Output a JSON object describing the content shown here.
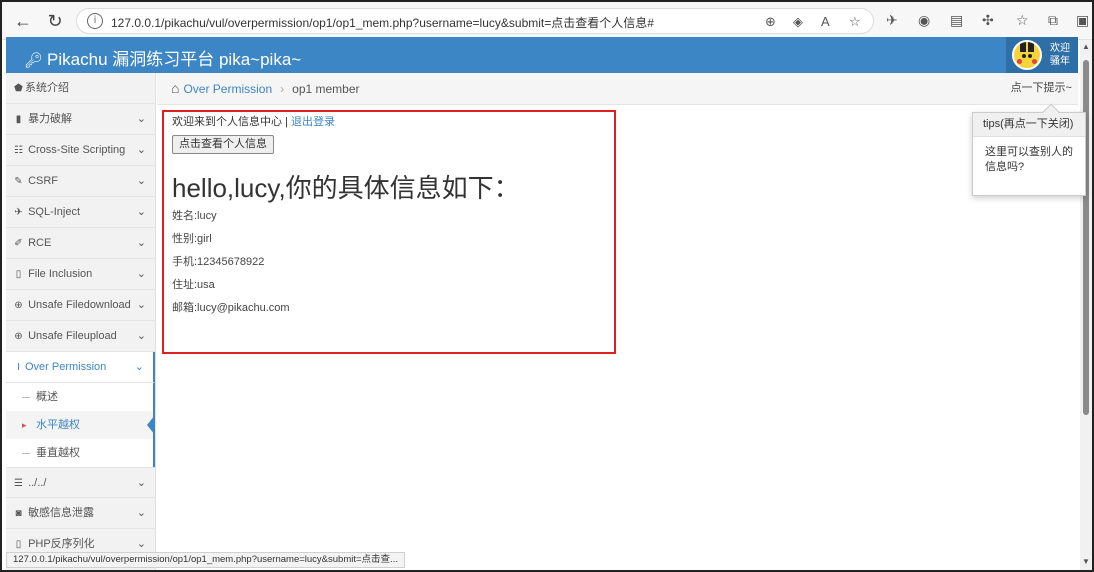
{
  "browser": {
    "back_glyph": "←",
    "reload_glyph": "↻",
    "url": "127.0.0.1/pikachu/vul/overpermission/op1/op1_mem.php?username=lucy&submit=点击查看个人信息#",
    "read_aloud_label": "A"
  },
  "header": {
    "title": "Pikachu 漏洞练习平台 pika~pika~",
    "greeting": "欢迎",
    "username": "骚年"
  },
  "sidebar": {
    "items": [
      {
        "icon": "tag-icon",
        "label": "系统介绍",
        "has_chevron": false
      },
      {
        "icon": "lock-icon",
        "label": "暴力破解",
        "has_chevron": true
      },
      {
        "icon": "list-icon",
        "label": "Cross-Site Scripting",
        "has_chevron": true
      },
      {
        "icon": "edit-icon",
        "label": "CSRF",
        "has_chevron": true
      },
      {
        "icon": "plane-icon",
        "label": "SQL-Inject",
        "has_chevron": true
      },
      {
        "icon": "pencil-icon",
        "label": "RCE",
        "has_chevron": true
      },
      {
        "icon": "file-icon",
        "label": "File Inclusion",
        "has_chevron": true
      },
      {
        "icon": "download-icon",
        "label": "Unsafe Filedownload",
        "has_chevron": true
      },
      {
        "icon": "upload-icon",
        "label": "Unsafe Fileupload",
        "has_chevron": true
      },
      {
        "icon": "text-icon",
        "label": "Over Permission",
        "has_chevron": true,
        "active": true
      }
    ],
    "subitems": [
      {
        "label": "概述"
      },
      {
        "label": "水平越权",
        "current": true
      },
      {
        "label": "垂直越权"
      }
    ],
    "items_after": [
      {
        "icon": "list-icon",
        "label": "../../",
        "has_chevron": true
      },
      {
        "icon": "camera-icon",
        "label": "敏感信息泄露",
        "has_chevron": true
      },
      {
        "icon": "file-icon",
        "label": "PHP反序列化",
        "has_chevron": true
      }
    ]
  },
  "breadcrumb": {
    "parent": "Over Permission",
    "separator": "›",
    "current": "op1 member",
    "tip_link": "点一下提示~"
  },
  "tips": {
    "title": "tips(再点一下关闭)",
    "body": "这里可以查别人的信息吗?"
  },
  "content": {
    "welcome": "欢迎来到个人信息中心 | ",
    "logout": "退出登录",
    "button": "点击查看个人信息",
    "heading": "hello,lucy,你的具体信息如下：",
    "fields": [
      "姓名:lucy",
      "性别:girl",
      "手机:12345678922",
      "住址:usa",
      "邮箱:lucy@pikachu.com"
    ]
  },
  "status_bar": "127.0.0.1/pikachu/vul/overpermission/op1/op1_mem.php?username=lucy&submit=点击查...",
  "colors": {
    "header_blue": "#3d86c6",
    "highlight_red": "#e02020",
    "link_blue": "#3d86c6"
  }
}
